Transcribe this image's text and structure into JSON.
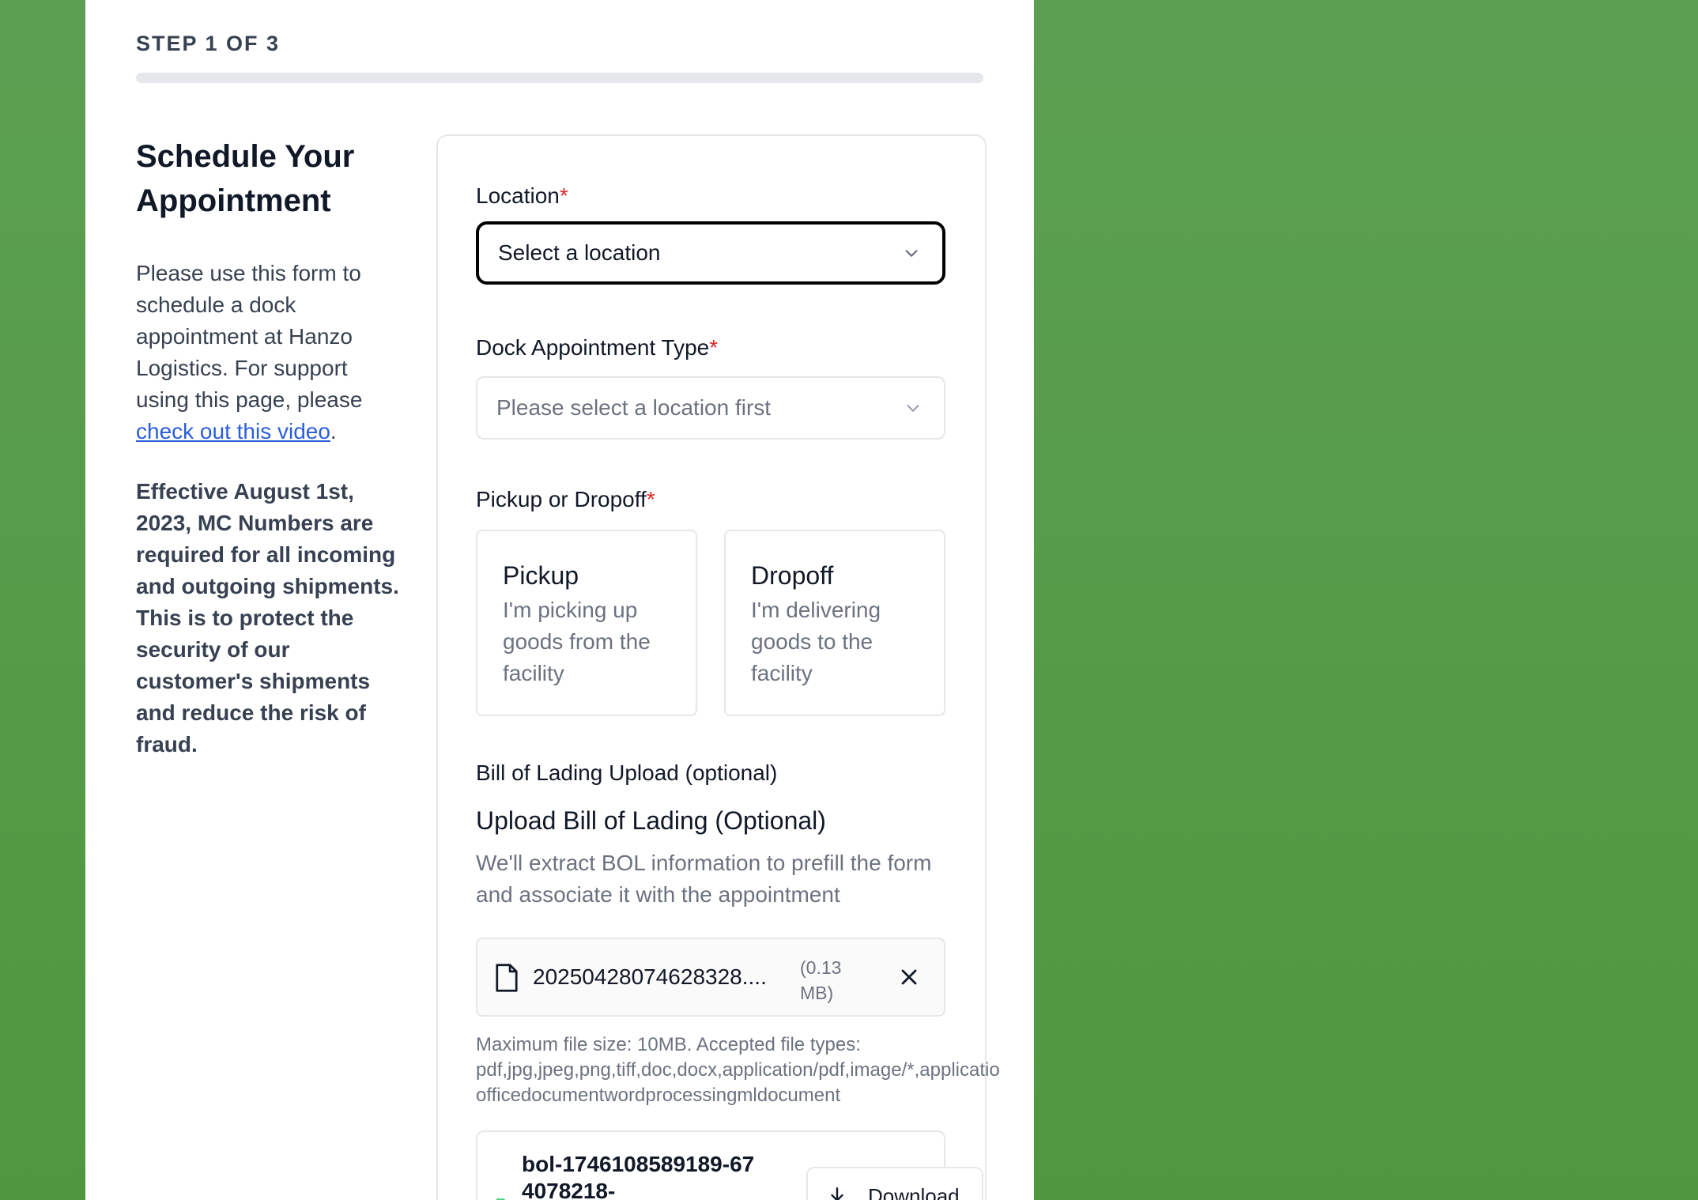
{
  "step": {
    "label": "STEP 1 OF 3",
    "progress_fraction": 0
  },
  "intro": {
    "title": "Schedule Your Appointment",
    "description_prefix": "Please use this form to schedule a dock appointment at Hanzo Logistics. For support using this page, please ",
    "video_link": "check out this video",
    "description_suffix": ".",
    "notice": "Effective August 1st, 2023, MC Numbers are required for all incoming and outgoing shipments. This is to protect the security of our customer's shipments and reduce the risk of fraud."
  },
  "form": {
    "location": {
      "label": "Location",
      "required_mark": "*",
      "value": "Select a location"
    },
    "appointment_type": {
      "label": "Dock Appointment Type",
      "required_mark": "*",
      "placeholder": "Please select a location first"
    },
    "pickup_dropoff": {
      "label": "Pickup or Dropoff",
      "required_mark": "*",
      "options": [
        {
          "title": "Pickup",
          "description": "I'm picking up goods from the facility"
        },
        {
          "title": "Dropoff",
          "description": "I'm delivering goods to the facility"
        }
      ]
    },
    "bol": {
      "section_label": "Bill of Lading Upload (optional)",
      "heading": "Upload Bill of Lading (Optional)",
      "description": "We'll extract BOL information to prefill the form and associate it with the appointment",
      "file": {
        "name": "20250428074628328....",
        "size": "(0.13 MB)"
      },
      "hint_line1": "Maximum file size: 10MB. Accepted file types:",
      "hint_line2": "pdf,jpg,jpeg,png,tiff,doc,docx,application/pdf,image/*,applicatio",
      "hint_line3": "officedocumentwordprocessingmldocument",
      "document": {
        "name": "bol-1746108589189-674078218-",
        "download_label": "Download"
      }
    }
  },
  "colors": {
    "background": "#559b48",
    "required": "#dc2626",
    "link": "#2b5fd9"
  },
  "icons": {
    "chevron": "chevron-down-icon",
    "file": "file-icon",
    "remove": "close-icon",
    "download": "download-icon"
  }
}
